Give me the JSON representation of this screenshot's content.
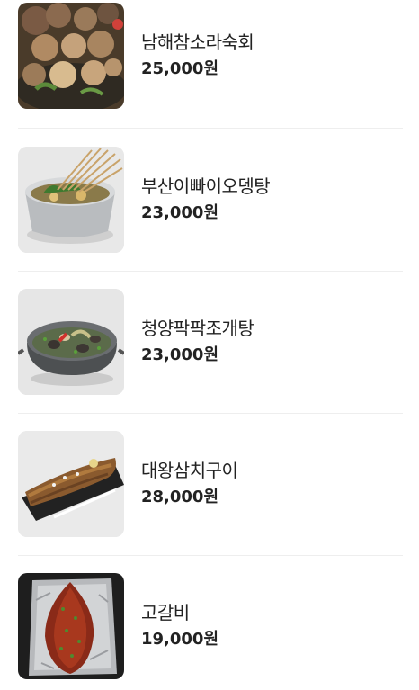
{
  "menu": {
    "items": [
      {
        "name": "남해참소라숙회",
        "price": "25,000원",
        "image_icon": "conch-sashimi-dish-icon"
      },
      {
        "name": "부산이빠이오뎅탕",
        "price": "23,000원",
        "image_icon": "fishcake-soup-pot-icon"
      },
      {
        "name": "청양팍팍조개탕",
        "price": "23,000원",
        "image_icon": "clam-soup-pot-icon"
      },
      {
        "name": "대왕삼치구이",
        "price": "28,000원",
        "image_icon": "grilled-mackerel-icon"
      },
      {
        "name": "고갈비",
        "price": "19,000원",
        "image_icon": "grilled-mackerel-foil-icon"
      }
    ]
  }
}
